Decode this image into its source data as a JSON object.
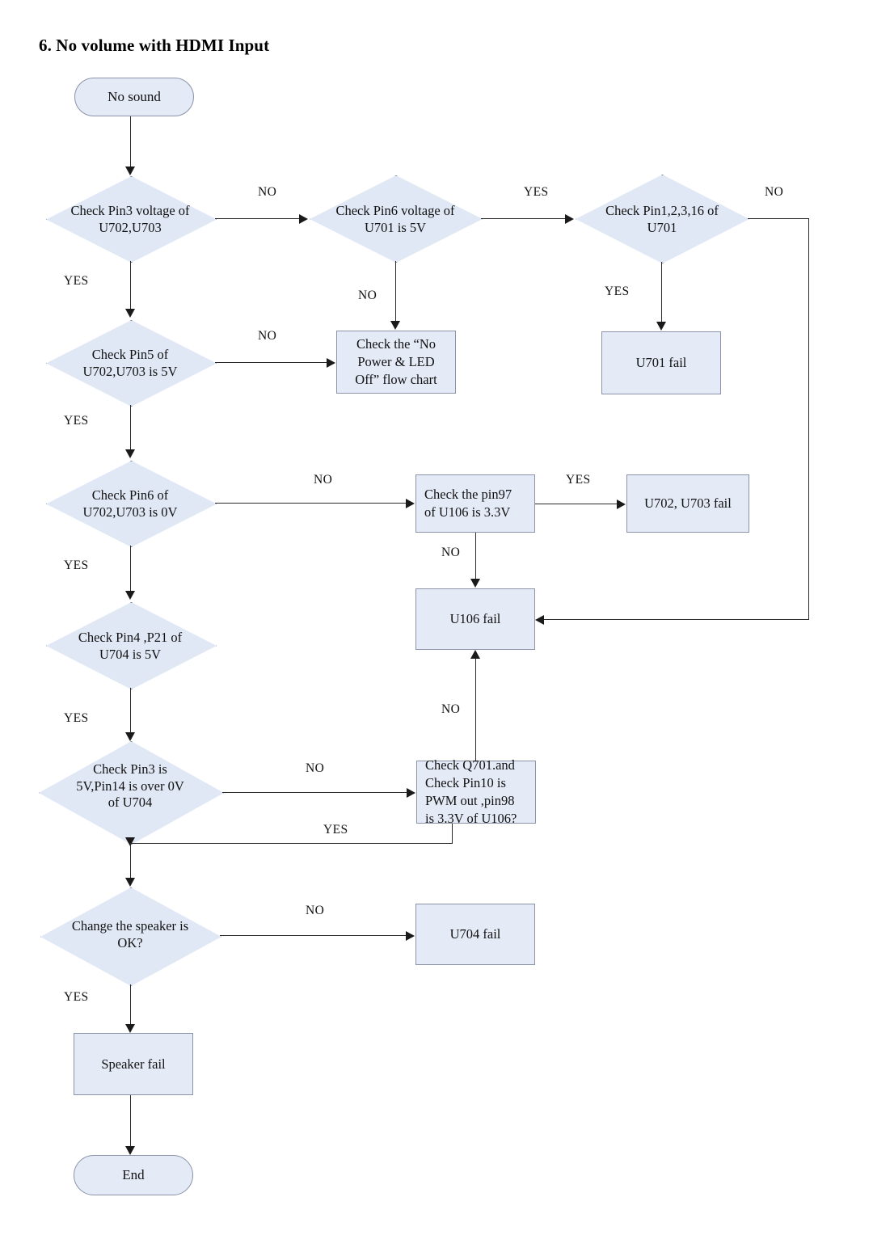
{
  "page": {
    "title": "6. No volume with HDMI Input",
    "shape_fill": "#e4eaf6",
    "shape_stroke": "#8a93a8",
    "connector_color": "#2a2a2a",
    "background": "#ffffff"
  },
  "chart_data": {
    "type": "diagram",
    "title": "6. No volume with HDMI Input",
    "diagram_kind": "flowchart",
    "nodes": [
      {
        "id": "start",
        "shape": "terminal",
        "text": "No sound"
      },
      {
        "id": "d_pin3_u702",
        "shape": "decision",
        "text_lines": [
          "Check Pin3 voltage of",
          "U702,U703"
        ]
      },
      {
        "id": "d_pin6_u701",
        "shape": "decision",
        "text_lines": [
          "Check Pin6 voltage of",
          "U701 is 5V"
        ]
      },
      {
        "id": "d_pin123_16",
        "shape": "decision",
        "text_lines": [
          "Check Pin1,2,3,16 of",
          "U701"
        ]
      },
      {
        "id": "d_pin5_u702",
        "shape": "decision",
        "text_lines": [
          "Check Pin5 of",
          "U702,U703 is 5V"
        ]
      },
      {
        "id": "b_nopower",
        "shape": "process",
        "text_lines": [
          "Check the  “No",
          "Power & LED",
          "Off”  flow chart"
        ]
      },
      {
        "id": "b_u701fail",
        "shape": "process",
        "text_lines": [
          "U701 fail"
        ]
      },
      {
        "id": "d_pin6_u702",
        "shape": "decision",
        "text_lines": [
          "Check Pin6 of",
          "U702,U703 is 0V"
        ]
      },
      {
        "id": "b_pin97",
        "shape": "process",
        "text_lines": [
          "Check the pin97",
          "of U106 is 3.3V"
        ]
      },
      {
        "id": "b_u702703fail",
        "shape": "process",
        "text_lines": [
          "U702, U703 fail"
        ]
      },
      {
        "id": "b_u106fail",
        "shape": "process",
        "text_lines": [
          "U106 fail"
        ]
      },
      {
        "id": "d_pin4_p21",
        "shape": "decision",
        "text_lines": [
          "Check Pin4 ,P21 of",
          "U704 is 5V"
        ]
      },
      {
        "id": "d_pin3_pin14",
        "shape": "decision",
        "text_lines": [
          "Check Pin3 is",
          "5V,Pin14 is over 0V",
          "of U704"
        ]
      },
      {
        "id": "b_q701",
        "shape": "process",
        "text_lines": [
          "Check Q701.and",
          "Check Pin10 is",
          "PWM out ,pin98",
          "is 3.3V of U106?"
        ]
      },
      {
        "id": "d_speaker",
        "shape": "decision",
        "text_lines": [
          "Change the speaker is",
          "OK?"
        ]
      },
      {
        "id": "b_u704fail",
        "shape": "process",
        "text_lines": [
          "U704 fail"
        ]
      },
      {
        "id": "b_speakerfail",
        "shape": "process",
        "text_lines": [
          "Speaker fail"
        ]
      },
      {
        "id": "end",
        "shape": "terminal",
        "text": "End"
      }
    ],
    "edges": [
      {
        "from": "start",
        "to": "d_pin3_u702",
        "label": ""
      },
      {
        "from": "d_pin3_u702",
        "to": "d_pin6_u701",
        "label": "NO"
      },
      {
        "from": "d_pin3_u702",
        "to": "d_pin5_u702",
        "label": "YES"
      },
      {
        "from": "d_pin6_u701",
        "to": "d_pin123_16",
        "label": "YES"
      },
      {
        "from": "d_pin6_u701",
        "to": "b_nopower",
        "label": "NO"
      },
      {
        "from": "d_pin123_16",
        "to": "b_u106fail",
        "label": "NO"
      },
      {
        "from": "d_pin123_16",
        "to": "b_u701fail",
        "label": "YES"
      },
      {
        "from": "d_pin5_u702",
        "to": "b_nopower",
        "label": "NO"
      },
      {
        "from": "d_pin5_u702",
        "to": "d_pin6_u702",
        "label": "YES"
      },
      {
        "from": "d_pin6_u702",
        "to": "b_pin97",
        "label": "NO"
      },
      {
        "from": "d_pin6_u702",
        "to": "d_pin4_p21",
        "label": "YES"
      },
      {
        "from": "b_pin97",
        "to": "b_u702703fail",
        "label": "YES"
      },
      {
        "from": "b_pin97",
        "to": "b_u106fail",
        "label": "NO"
      },
      {
        "from": "d_pin4_p21",
        "to": "d_pin3_pin14",
        "label": "YES"
      },
      {
        "from": "d_pin3_pin14",
        "to": "b_q701",
        "label": "NO"
      },
      {
        "from": "d_pin3_pin14",
        "to": "d_speaker",
        "label": "YES"
      },
      {
        "from": "b_q701",
        "to": "b_u106fail",
        "label": "NO"
      },
      {
        "from": "b_q701",
        "to": "d_speaker",
        "label": "YES"
      },
      {
        "from": "d_speaker",
        "to": "b_u704fail",
        "label": "NO"
      },
      {
        "from": "d_speaker",
        "to": "b_speakerfail",
        "label": "YES"
      },
      {
        "from": "b_speakerfail",
        "to": "end",
        "label": ""
      }
    ]
  },
  "nodes": {
    "start": {
      "text": "No sound"
    },
    "d_pin3_u702": {
      "l1": "Check Pin3 voltage of",
      "l2": "U702,U703"
    },
    "d_pin6_u701": {
      "l1": "Check Pin6 voltage of",
      "l2": "U701 is 5V"
    },
    "d_pin123_16": {
      "l1": "Check Pin1,2,3,16 of",
      "l2": "U701"
    },
    "d_pin5_u702": {
      "l1": "Check Pin5 of",
      "l2": "U702,U703 is 5V"
    },
    "b_nopower": {
      "l1": "Check the  “No",
      "l2": "Power & LED",
      "l3": "Off”  flow chart"
    },
    "b_u701fail": {
      "l1": "U701 fail"
    },
    "d_pin6_u702": {
      "l1": "Check Pin6 of",
      "l2": "U702,U703 is 0V"
    },
    "b_pin97": {
      "l1": "Check the pin97",
      "l2": "of U106 is 3.3V"
    },
    "b_u702703fail": {
      "l1": "U702, U703 fail"
    },
    "b_u106fail": {
      "l1": "U106 fail"
    },
    "d_pin4_p21": {
      "l1": "Check Pin4 ,P21 of",
      "l2": "U704 is 5V"
    },
    "d_pin3_pin14": {
      "l1": "Check Pin3 is",
      "l2": "5V,Pin14 is over 0V",
      "l3": "of U704"
    },
    "b_q701": {
      "l1": "Check Q701.and",
      "l2": "Check Pin10 is",
      "l3": "PWM out ,pin98",
      "l4": "is 3.3V of U106?"
    },
    "d_speaker": {
      "l1": "Change the speaker is",
      "l2": "OK?"
    },
    "b_u704fail": {
      "l1": "U704 fail"
    },
    "b_speakerfail": {
      "l1": "Speaker fail"
    },
    "end": {
      "text": "End"
    }
  },
  "edge_labels": {
    "e1_no": "NO",
    "e1_yes": "YES",
    "e2_yes": "YES",
    "e2_no": "NO",
    "e3_no": "NO",
    "e3_yes": "YES",
    "e4_no": "NO",
    "e4_yes": "YES",
    "e5_no": "NO",
    "e5_yes": "YES",
    "e6_yes": "YES",
    "e6_no": "NO",
    "e7_yes": "YES",
    "e8_no": "NO",
    "e8_yes": "YES",
    "e9_no": "NO",
    "e10_no": "NO",
    "e10_yes": "YES"
  }
}
